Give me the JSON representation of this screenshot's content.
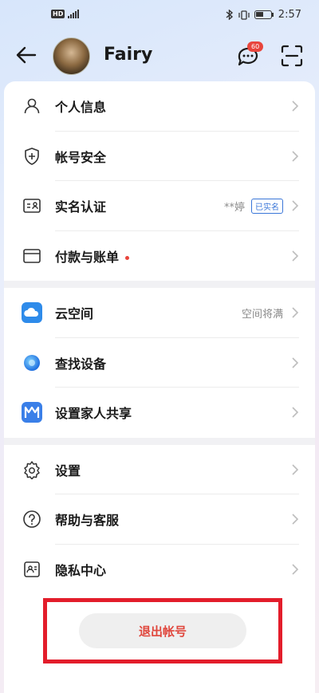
{
  "status_bar": {
    "network_label": "HD",
    "time": "2:57"
  },
  "header": {
    "username": "Fairy",
    "message_badge": "60",
    "icons": [
      "back-arrow-icon",
      "message-icon",
      "scan-icon"
    ]
  },
  "groups": [
    {
      "items": [
        {
          "label": "个人信息",
          "icon": "person-icon"
        },
        {
          "label": "帐号安全",
          "icon": "shield-icon"
        },
        {
          "label": "实名认证",
          "icon": "id-card-icon",
          "right_text": "**婷",
          "badge": "已实名"
        },
        {
          "label": "付款与账单",
          "icon": "card-icon",
          "dot": true
        }
      ]
    },
    {
      "items": [
        {
          "label": "云空间",
          "icon": "cloud-icon",
          "right_text": "空间将满"
        },
        {
          "label": "查找设备",
          "icon": "find-device-icon"
        },
        {
          "label": "设置家人共享",
          "icon": "family-share-icon"
        }
      ]
    },
    {
      "items": [
        {
          "label": "设置",
          "icon": "gear-icon"
        },
        {
          "label": "帮助与客服",
          "icon": "help-icon"
        },
        {
          "label": "隐私中心",
          "icon": "privacy-icon"
        }
      ]
    }
  ],
  "logout": {
    "label": "退出帐号"
  },
  "colors": {
    "accent_red": "#e31d2b",
    "verified_blue": "#3a76d8",
    "cloud_blue": "#2e8bea"
  }
}
